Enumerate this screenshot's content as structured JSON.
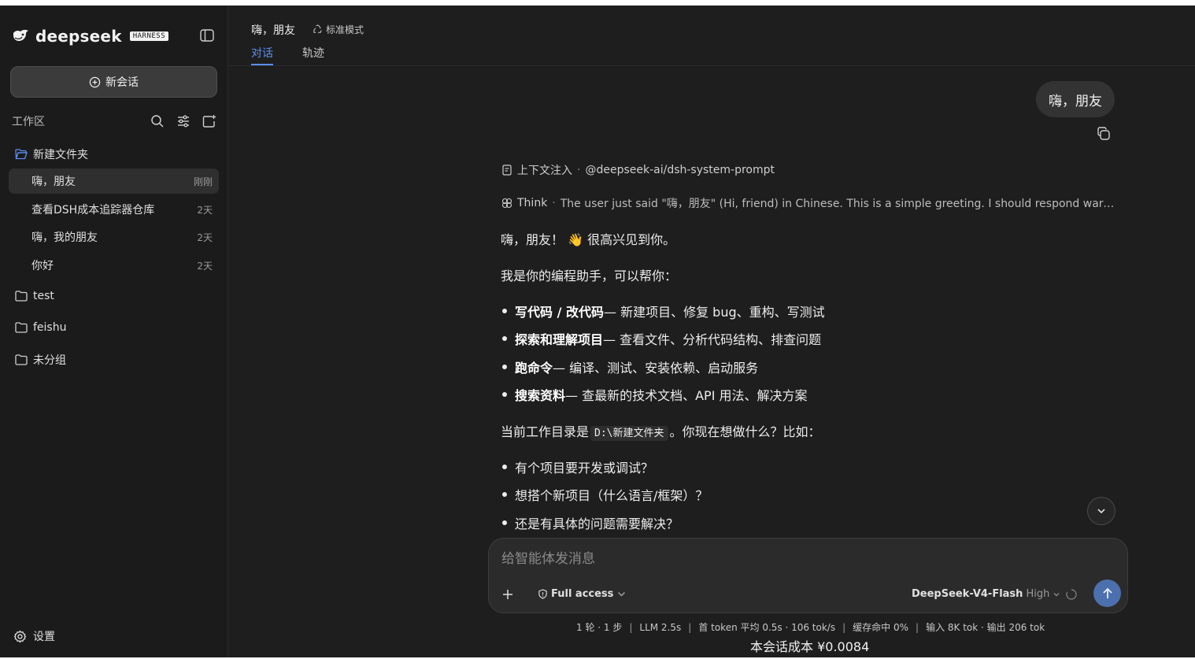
{
  "sidebar": {
    "brand": "deepseek",
    "badge": "HARNESS",
    "new_chat_label": "新会话",
    "workspace_label": "工作区",
    "folders": [
      {
        "name": "新建文件夹"
      },
      {
        "name": "test"
      },
      {
        "name": "feishu"
      },
      {
        "name": "未分组"
      }
    ],
    "chats": [
      {
        "title": "嗨，朋友",
        "time": "刚刚"
      },
      {
        "title": "查看DSH成本追踪器仓库",
        "time": "2天"
      },
      {
        "title": "嗨，我的朋友",
        "time": "2天"
      },
      {
        "title": "你好",
        "time": "2天"
      }
    ],
    "settings_label": "设置"
  },
  "header": {
    "title": "嗨，朋友",
    "mode": "标准模式",
    "tabs": [
      {
        "label": "对话"
      },
      {
        "label": "轨迹"
      }
    ]
  },
  "conversation": {
    "user_message": "嗨，朋友",
    "context_label": "上下文注入",
    "context_value": "@deepseek-ai/dsh-system-prompt",
    "think_label": "Think",
    "think_text": "The user just said \"嗨，朋友\" (Hi, friend) in Chinese. This is a simple greeting. I should respond warmly in Ch...",
    "greeting": "嗨，朋友！ 👋 很高兴见到你。",
    "intro": "我是你的编程助手，可以帮你：",
    "capabilities": [
      {
        "title": "写代码 / 改代码",
        "desc": " — 新建项目、修复 bug、重构、写测试"
      },
      {
        "title": "探索和理解项目",
        "desc": " — 查看文件、分析代码结构、排查问题"
      },
      {
        "title": "跑命令",
        "desc": " — 编译、测试、安装依赖、启动服务"
      },
      {
        "title": "搜索资料",
        "desc": " — 查最新的技术文档、API 用法、解决方案"
      }
    ],
    "cwd_prefix": "当前工作目录是",
    "cwd_path": "D:\\新建文件夹",
    "cwd_suffix": "。你现在想做什么？比如：",
    "suggestions": [
      "有个项目要开发或调试？",
      "想搭个新项目（什么语言/框架）？",
      "还是有具体的问题需要解决？"
    ]
  },
  "composer": {
    "placeholder": "给智能体发消息",
    "access_label": "Full access",
    "model_name": "DeepSeek-V4-Flash",
    "model_level": "High"
  },
  "stats": {
    "rounds": "1 轮 · 1 步",
    "llm": "LLM 2.5s",
    "first_token": "首 token 平均 0.5s · 106 tok/s",
    "cache": "缓存命中 0%",
    "tokens": "输入 8K tok · 输出 206 tok",
    "cost": "本会话成本 ¥0.0084"
  }
}
